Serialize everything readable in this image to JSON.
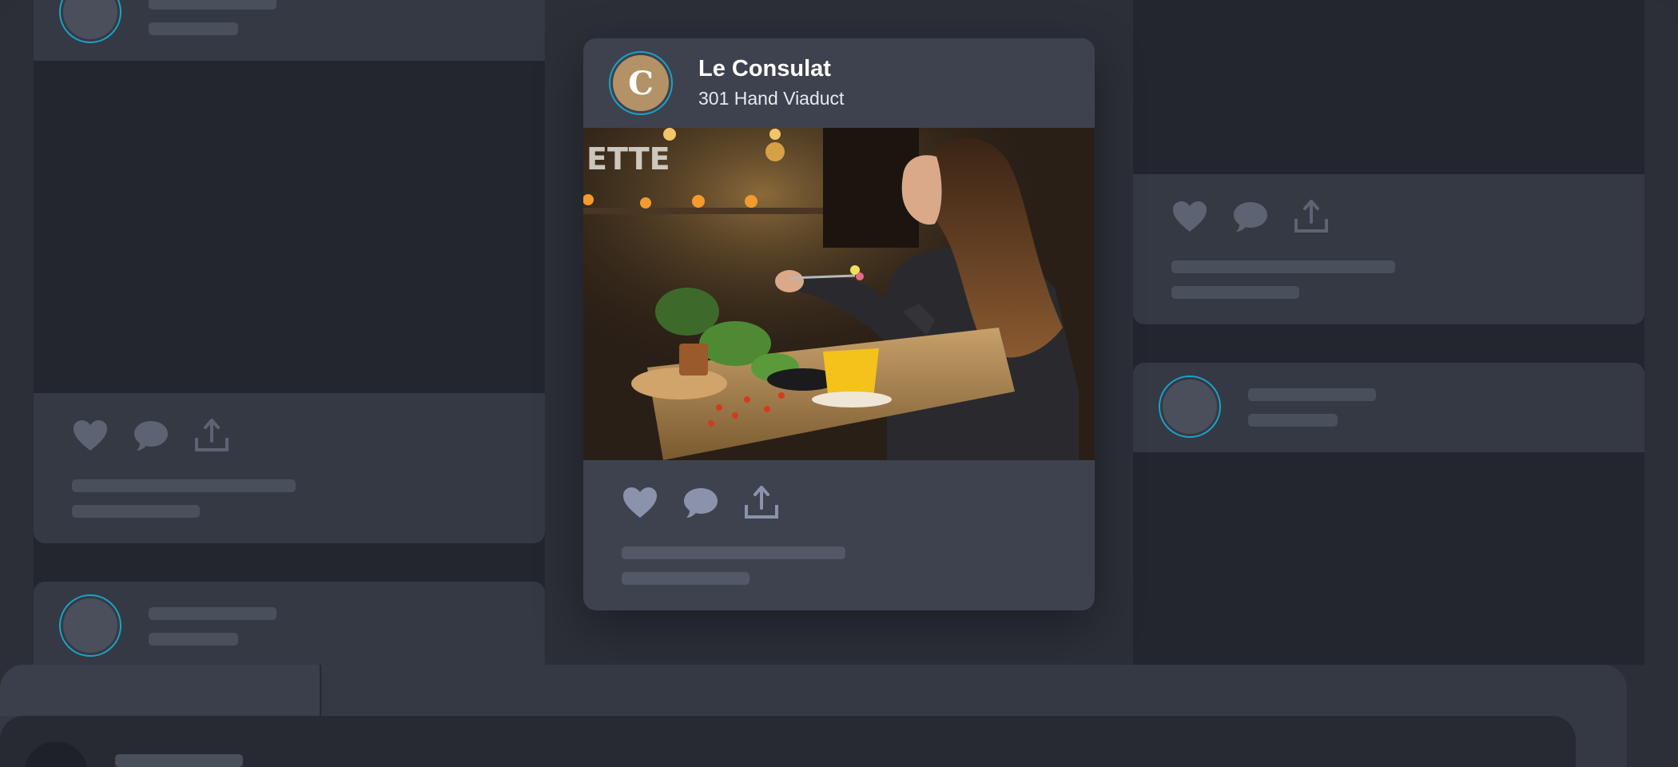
{
  "featured_post": {
    "brand_initial": "C",
    "name": "Le Consulat",
    "address": "301 Hand Viaduct",
    "photo": "woman-dining-in-cafe",
    "actions": [
      "heart-icon",
      "comment-icon",
      "share-icon"
    ]
  },
  "colors": {
    "background": "#2c2f38",
    "column": "#23262f",
    "card": "#353944",
    "featured_card": "#3e424e",
    "accent_ring": "#1aa3c8",
    "brand_logo": "#b39268",
    "icon_active": "#8a93ab",
    "icon_muted": "#5d6373",
    "skeleton": "#4a4f5c"
  }
}
